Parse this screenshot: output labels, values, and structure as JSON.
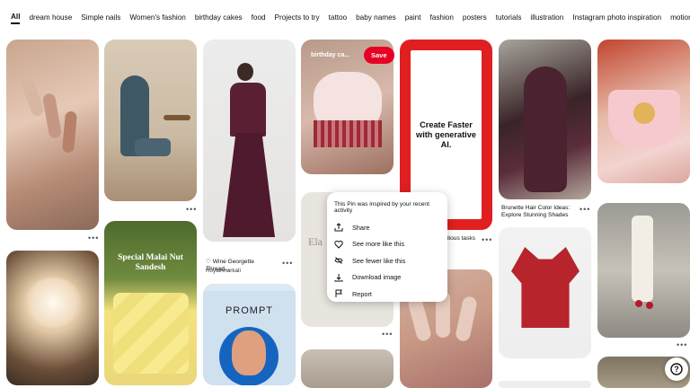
{
  "categories": [
    "All",
    "dream house",
    "Simple nails",
    "Women's fashion",
    "birthday cakes",
    "food",
    "Projects to try",
    "tattoo",
    "baby names",
    "paint",
    "fashion",
    "posters",
    "tutorials",
    "illustration",
    "Instagram photo inspiration",
    "motion graphics"
  ],
  "pins": {
    "cake": {
      "title": "birthday ca...",
      "save_label": "Save"
    },
    "ad": {
      "text": "Create Faster with generative AI."
    },
    "dress": {
      "title": "Wine Georgette Thread...",
      "source": "RoyalAnarkali"
    },
    "hair": {
      "title": "Brunette Hair Color Ideas: Explore Stunning Shades"
    },
    "malai": {
      "title": "Special Malai Nut Sandesh"
    },
    "prompt": {
      "title": "PROMPT"
    },
    "elan": {
      "text": "Ela"
    },
    "partial_task": {
      "text": "dious tasks"
    }
  },
  "menu": {
    "header": "This Pin was inspired by your recent activity",
    "items": [
      {
        "label": "Share",
        "icon": "share-icon"
      },
      {
        "label": "See more like this",
        "icon": "heart-icon"
      },
      {
        "label": "See fewer like this",
        "icon": "eye-slash-icon"
      },
      {
        "label": "Download image",
        "icon": "download-icon"
      },
      {
        "label": "Report",
        "icon": "flag-icon"
      }
    ]
  },
  "dots": "•••",
  "help": "?",
  "colors": {
    "save": "#e60023",
    "ad_frame": "#e02020"
  }
}
